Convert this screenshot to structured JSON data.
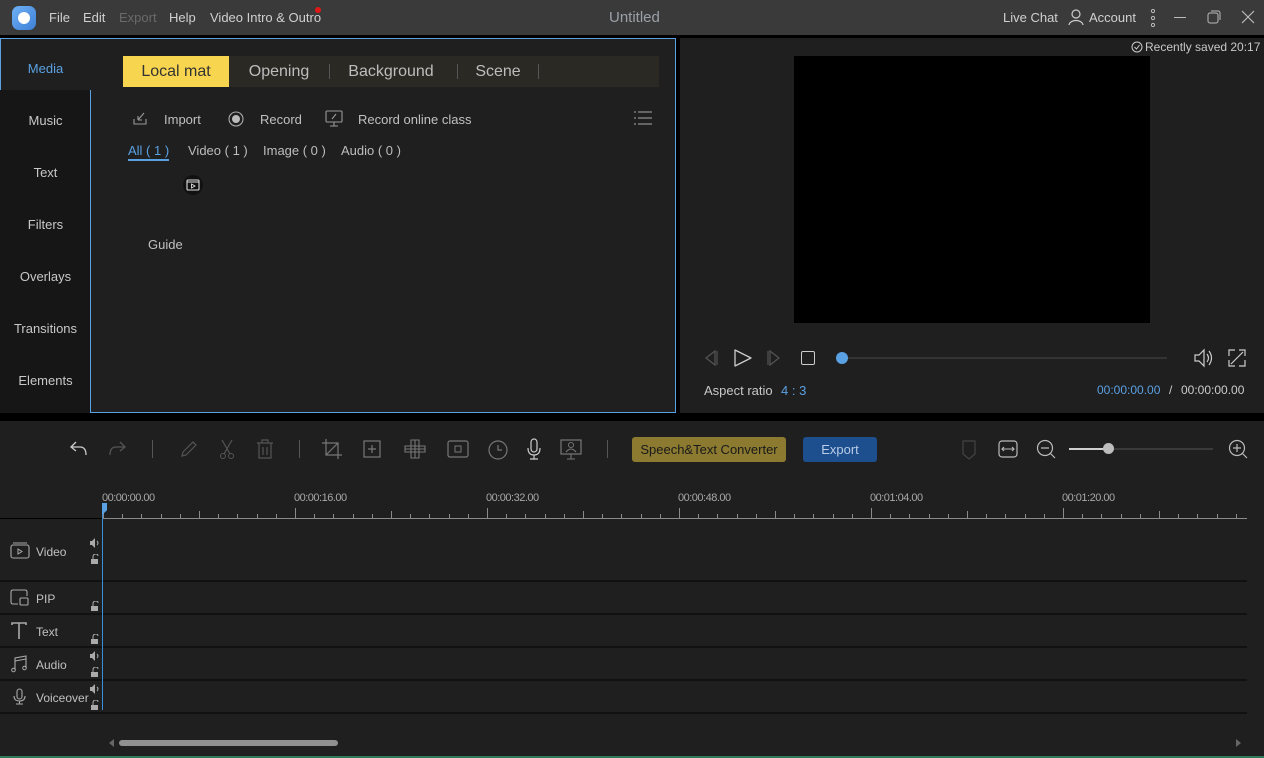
{
  "titlebar": {
    "menus": [
      "File",
      "Edit",
      "Export",
      "Help",
      "Video Intro & Outro"
    ],
    "disabled_menus": [
      "Export"
    ],
    "document_title": "Untitled",
    "live_chat": "Live Chat",
    "account": "Account"
  },
  "sidebar": {
    "items": [
      {
        "label": "Media",
        "active": true
      },
      {
        "label": "Music"
      },
      {
        "label": "Text"
      },
      {
        "label": "Filters"
      },
      {
        "label": "Overlays"
      },
      {
        "label": "Transitions"
      },
      {
        "label": "Elements"
      }
    ]
  },
  "media": {
    "tabs": [
      {
        "label": "Local mat",
        "active": true
      },
      {
        "label": "Opening"
      },
      {
        "label": "Background"
      },
      {
        "label": "Scene"
      }
    ],
    "tools": {
      "import": "Import",
      "record": "Record",
      "record_online_class": "Record online class"
    },
    "filters": [
      {
        "label": "All ( 1 )",
        "active": true
      },
      {
        "label": "Video ( 1 )"
      },
      {
        "label": "Image ( 0 )"
      },
      {
        "label": "Audio ( 0 )"
      }
    ],
    "items": [
      {
        "label": "Guide"
      }
    ]
  },
  "preview": {
    "saved_status": "Recently saved 20:17",
    "aspect_ratio_label": "Aspect ratio",
    "aspect_ratio_value": "4 : 3",
    "current_time": "00:00:00.00",
    "time_separator": "/",
    "total_time": "00:00:00.00",
    "progress": 0
  },
  "timeline_toolbar": {
    "speech_text_converter": "Speech&Text Converter",
    "export": "Export",
    "zoom_level": 0.27
  },
  "timeline": {
    "ruler_labels": [
      "00:00:00.00",
      "00:00:16.00",
      "00:00:32.00",
      "00:00:48.00",
      "00:01:04.00",
      "00:01:20.00"
    ],
    "tracks": [
      {
        "label": "Video"
      },
      {
        "label": "PIP"
      },
      {
        "label": "Text"
      },
      {
        "label": "Audio"
      },
      {
        "label": "Voiceover"
      }
    ]
  },
  "colors": {
    "accent": "#5aa1e3",
    "tab_active": "#f7d54f",
    "speech_button": "#8b7a30",
    "export_button": "#1d4f8e"
  }
}
